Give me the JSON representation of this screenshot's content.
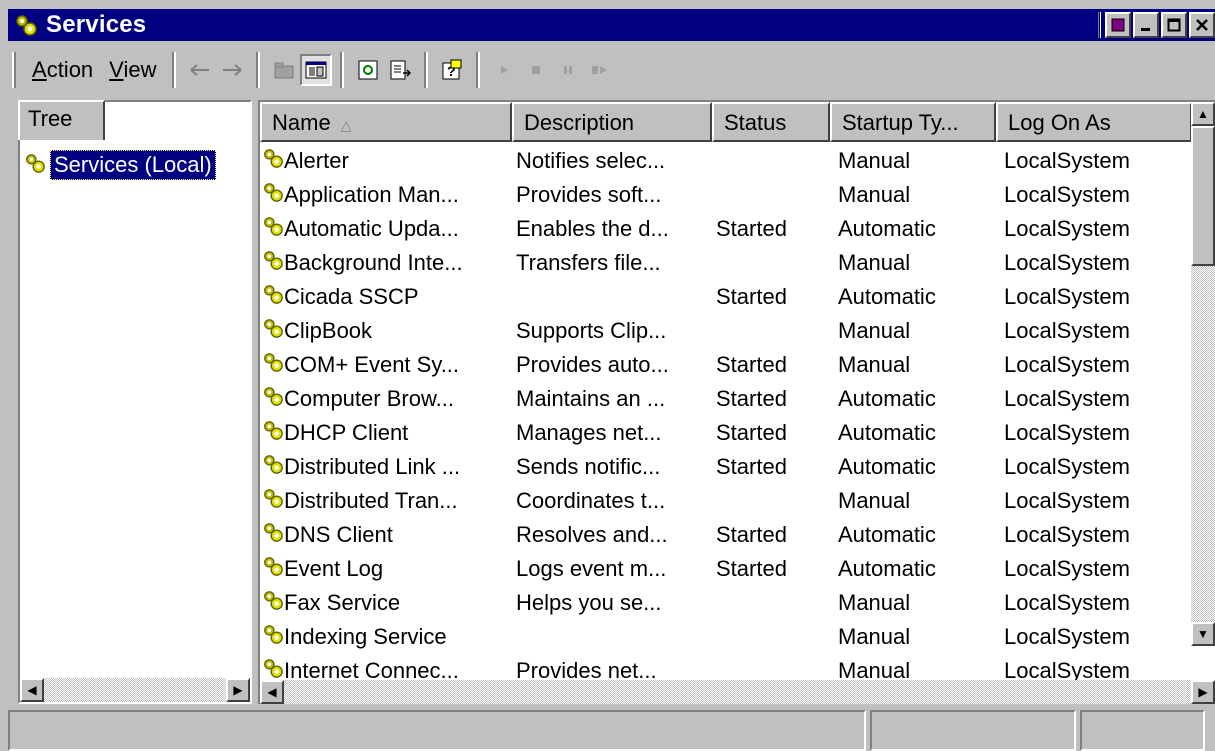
{
  "window": {
    "title": "Services",
    "icon": "services-gear-icon"
  },
  "menu": {
    "items": [
      {
        "label": "Action",
        "accel": "A"
      },
      {
        "label": "View",
        "accel": "V"
      }
    ]
  },
  "toolbar": {
    "icons": [
      "back-arrow-icon",
      "forward-arrow-icon",
      "up-folder-icon",
      "show-hide-tree-icon",
      "refresh-icon",
      "export-list-icon",
      "help-icon",
      "start-service-icon",
      "stop-service-icon",
      "pause-service-icon",
      "restart-service-icon"
    ]
  },
  "tree": {
    "tab_label": "Tree",
    "item_label": "Services (Local)"
  },
  "list": {
    "columns": [
      "Name",
      "Description",
      "Status",
      "Startup Ty...",
      "Log On As"
    ],
    "rows": [
      {
        "name": "Alerter",
        "description": "Notifies selec...",
        "status": "",
        "startup": "Manual",
        "logon": "LocalSystem"
      },
      {
        "name": "Application Man...",
        "description": "Provides soft...",
        "status": "",
        "startup": "Manual",
        "logon": "LocalSystem"
      },
      {
        "name": "Automatic Upda...",
        "description": "Enables the d...",
        "status": "Started",
        "startup": "Automatic",
        "logon": "LocalSystem"
      },
      {
        "name": "Background Inte...",
        "description": "Transfers file...",
        "status": "",
        "startup": "Manual",
        "logon": "LocalSystem"
      },
      {
        "name": "Cicada SSCP",
        "description": "",
        "status": "Started",
        "startup": "Automatic",
        "logon": "LocalSystem"
      },
      {
        "name": "ClipBook",
        "description": "Supports Clip...",
        "status": "",
        "startup": "Manual",
        "logon": "LocalSystem"
      },
      {
        "name": "COM+ Event Sy...",
        "description": "Provides auto...",
        "status": "Started",
        "startup": "Manual",
        "logon": "LocalSystem"
      },
      {
        "name": "Computer Brow...",
        "description": "Maintains an ...",
        "status": "Started",
        "startup": "Automatic",
        "logon": "LocalSystem"
      },
      {
        "name": "DHCP Client",
        "description": "Manages net...",
        "status": "Started",
        "startup": "Automatic",
        "logon": "LocalSystem"
      },
      {
        "name": "Distributed Link ...",
        "description": "Sends notific...",
        "status": "Started",
        "startup": "Automatic",
        "logon": "LocalSystem"
      },
      {
        "name": "Distributed Tran...",
        "description": "Coordinates t...",
        "status": "",
        "startup": "Manual",
        "logon": "LocalSystem"
      },
      {
        "name": "DNS Client",
        "description": "Resolves and...",
        "status": "Started",
        "startup": "Automatic",
        "logon": "LocalSystem"
      },
      {
        "name": "Event Log",
        "description": "Logs event m...",
        "status": "Started",
        "startup": "Automatic",
        "logon": "LocalSystem"
      },
      {
        "name": "Fax Service",
        "description": "Helps you se...",
        "status": "",
        "startup": "Manual",
        "logon": "LocalSystem"
      },
      {
        "name": "Indexing Service",
        "description": "",
        "status": "",
        "startup": "Manual",
        "logon": "LocalSystem"
      },
      {
        "name": "Internet Connec...",
        "description": "Provides net...",
        "status": "",
        "startup": "Manual",
        "logon": "LocalSystem"
      }
    ]
  },
  "colors": {
    "titlebar": "#000080",
    "face": "#c0c0c0",
    "selection": "#000080"
  }
}
